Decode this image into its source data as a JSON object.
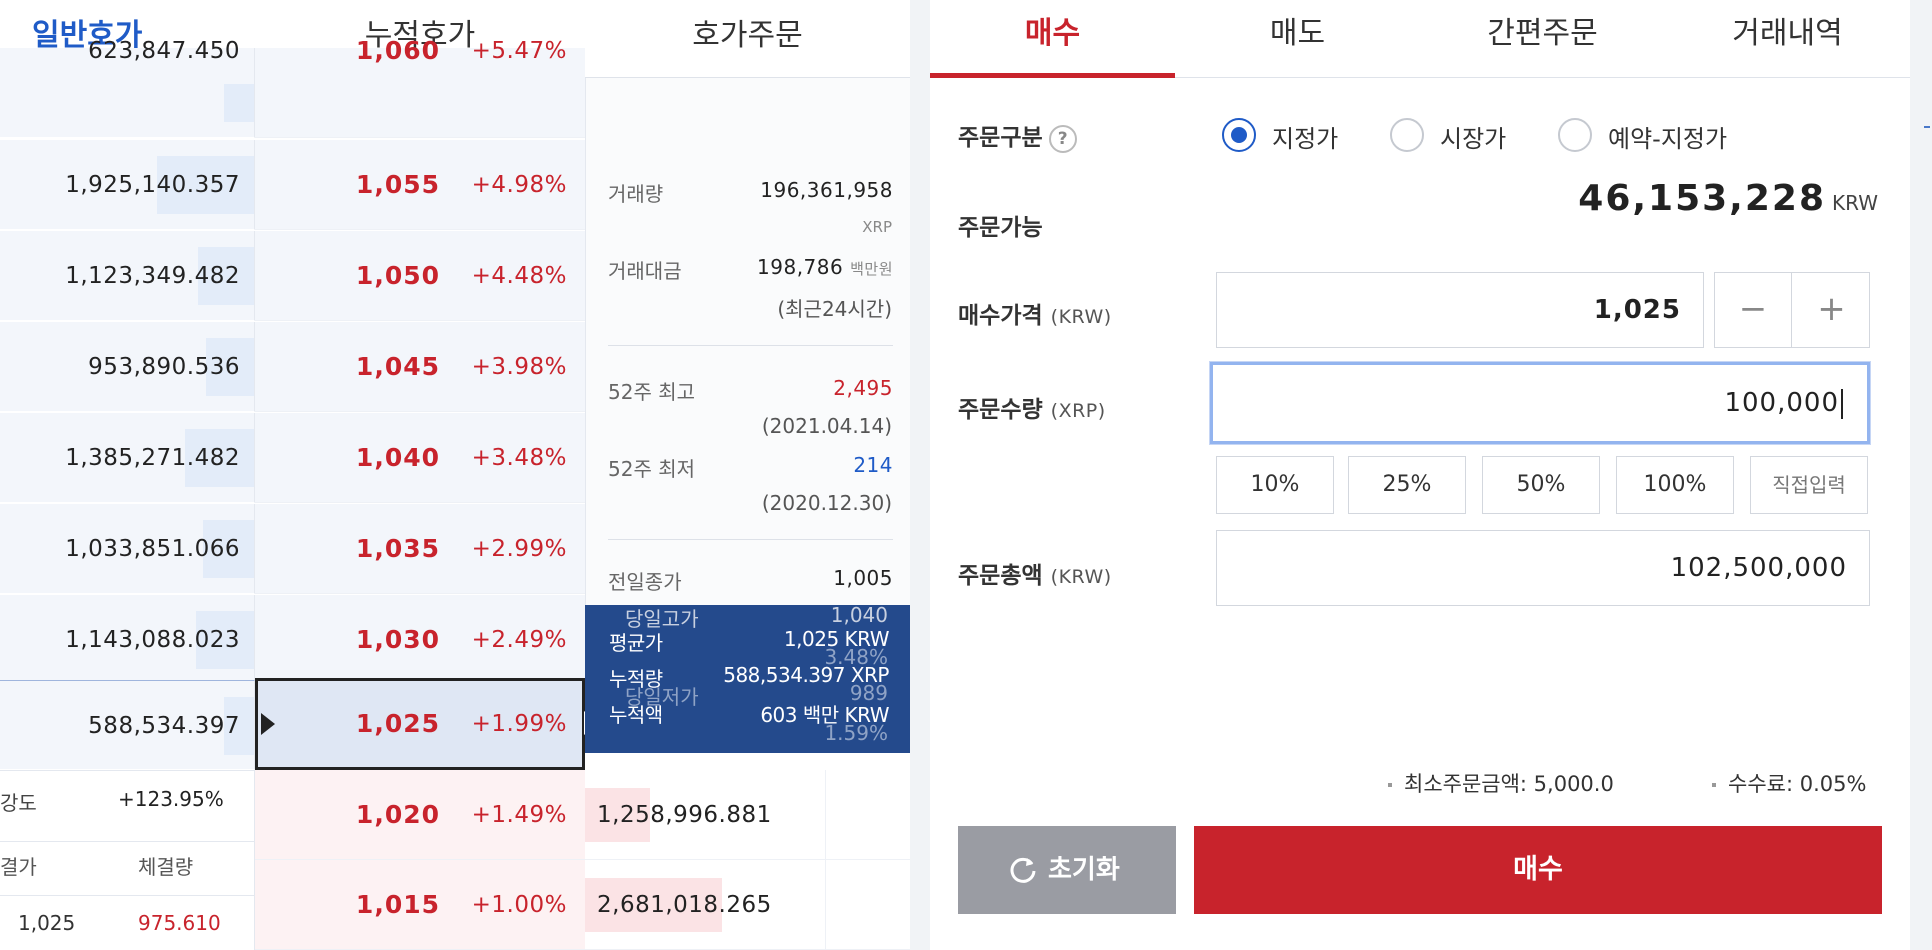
{
  "orderbook": {
    "tabs": [
      "일반호가",
      "누적호가",
      "호가주문"
    ],
    "asks": [
      {
        "qty": "623,847.450",
        "price": "1,060",
        "pct": "+5.47%",
        "bar": 0.12
      },
      {
        "qty": "1,925,140.357",
        "price": "1,055",
        "pct": "+4.98%",
        "bar": 0.38
      },
      {
        "qty": "1,123,349.482",
        "price": "1,050",
        "pct": "+4.48%",
        "bar": 0.22
      },
      {
        "qty": "953,890.536",
        "price": "1,045",
        "pct": "+3.98%",
        "bar": 0.19
      },
      {
        "qty": "1,385,271.482",
        "price": "1,040",
        "pct": "+3.48%",
        "bar": 0.27
      },
      {
        "qty": "1,033,851.066",
        "price": "1,035",
        "pct": "+2.99%",
        "bar": 0.2
      },
      {
        "qty": "1,143,088.023",
        "price": "1,030",
        "pct": "+2.49%",
        "bar": 0.23
      },
      {
        "qty": "588,534.397",
        "price": "1,025",
        "pct": "+1.99%",
        "bar": 0.12
      }
    ],
    "bids": [
      {
        "qty": "1,258,996.881",
        "price": "1,020",
        "pct": "+1.49%",
        "bar": 0.2
      },
      {
        "qty": "2,681,018.265",
        "price": "1,015",
        "pct": "+1.00%",
        "bar": 0.42
      }
    ],
    "stats": {
      "strength_label": "강도",
      "strength_value": "+123.95%",
      "trade_price_header": "결가",
      "trade_qty_header": "체결량",
      "trade_price": "1,025",
      "trade_qty": "975.610"
    },
    "info": {
      "volume_label": "거래량",
      "volume_value": "196,361,958",
      "volume_unit": "XRP",
      "amount_label": "거래대금",
      "amount_value": "198,786",
      "amount_unit": "백만원",
      "amount_note": "(최근24시간)",
      "high52_label": "52주 최고",
      "high52_value": "2,495",
      "high52_date": "(2021.04.14)",
      "low52_label": "52주 최저",
      "low52_value": "214",
      "low52_date": "(2020.12.30)",
      "prev_close_label": "전일종가",
      "prev_close_value": "1,005",
      "hidden_label_1": "당일고가",
      "hidden_value_1": "1,040",
      "hidden_value_2": "3.48%",
      "hidden_label_2": "당일저가",
      "hidden_value_3": "989",
      "hidden_value_4": "1.59%"
    },
    "tooltip": {
      "avg_label": "평균가",
      "avg_value": "1,025 KRW",
      "cum_qty_label": "누적량",
      "cum_qty_value": "588,534.397 XRP",
      "cum_amt_label": "누적액",
      "cum_amt_value": "603 백만 KRW"
    }
  },
  "order_form": {
    "tabs": [
      "매수",
      "매도",
      "간편주문",
      "거래내역"
    ],
    "order_type_label": "주문구분",
    "help_symbol": "?",
    "order_types": [
      "지정가",
      "시장가",
      "예약-지정가"
    ],
    "selected_order_type": "지정가",
    "available_label": "주문가능",
    "available_value": "46,153,228",
    "available_currency": "KRW",
    "price_label": "매수가격",
    "price_unit": "(KRW)",
    "price_value": "1,025",
    "minus_symbol": "−",
    "plus_symbol": "+",
    "qty_label": "주문수량",
    "qty_unit": "(XRP)",
    "qty_value": "100,000",
    "pct_buttons": [
      "10%",
      "25%",
      "50%",
      "100%",
      "직접입력"
    ],
    "total_label": "주문총액",
    "total_unit": "(KRW)",
    "total_value": "102,500,000",
    "min_order": "최소주문금액: 5,000.0",
    "fee": "수수료: 0.05%",
    "reset_label": "초기화",
    "buy_label": "매수",
    "colors": {
      "buy": "#c8232c",
      "accent_blue": "#1f5bc7",
      "reset_gray": "#9a9ca3"
    }
  }
}
